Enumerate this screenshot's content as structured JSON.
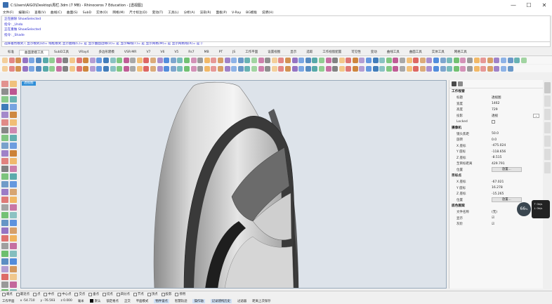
{
  "window": {
    "title": "C:\\Users\\AIGO\\Desktop\\周栏.3dm (7 MB) - Rhinoceros 7 Education - [透视图]",
    "buttons": [
      "minimize-icon",
      "maximize-icon",
      "close-icon"
    ],
    "btn_glyphs": [
      "—",
      "☐",
      "✕"
    ]
  },
  "menubar": [
    "文件(F)",
    "编辑(E)",
    "查看(V)",
    "曲线(C)",
    "曲面(S)",
    "SubD",
    "实体(O)",
    "网格(M)",
    "尺寸标注(D)",
    "变动(T)",
    "工具(L)",
    "分析(A)",
    "渲染(R)",
    "面板(P)",
    "V-Ray",
    "BG模板",
    "说明(H)"
  ],
  "command_history": [
    "正在删除 ShowSelected",
    "指令: _Undo",
    "正在重做 ShowSelected",
    "指令: _Shade"
  ],
  "command_prompt": "选择着色模式 ( 显示模式(D)= 线框模式 显示曲线(C)= 是 显示曲面边缘(U)= 是 显示细线(T)= 是 显示网格(M)= 是 显示网格线(X)= 是 ):",
  "tabs": [
    "标准",
    "曲面建模工具",
    "SubD工具",
    "VRay4",
    "多边形建模",
    "VSR-MR",
    "V7",
    "V6",
    "V5",
    "Rs7",
    "MB",
    "PT",
    "JS",
    "工作平面",
    "设置视图",
    "显示",
    "选取",
    "工作视窗配置",
    "可见性",
    "变动",
    "曲线工具",
    "曲面工具",
    "实体工具",
    "网格工具"
  ],
  "active_tab_index": 1,
  "viewport": {
    "label": "透视图"
  },
  "properties": {
    "section_viewport": "工作视窗",
    "rows_viewport": [
      {
        "k": "标题",
        "v": "透视图"
      },
      {
        "k": "宽度",
        "v": "1462"
      },
      {
        "k": "高度",
        "v": "729"
      },
      {
        "k": "投影",
        "v": "透视"
      },
      {
        "k": "Locked",
        "v": ""
      }
    ],
    "section_camera": "摄像机",
    "rows_camera": [
      {
        "k": "镜头焦距",
        "v": "50.0"
      },
      {
        "k": "旋转",
        "v": "0.0"
      },
      {
        "k": "X 座标",
        "v": "-475.024"
      },
      {
        "k": "Y 座标",
        "v": "-118.656"
      },
      {
        "k": "Z 座标",
        "v": "-8.515"
      },
      {
        "k": "至目标距离",
        "v": "429.791"
      },
      {
        "k": "位置",
        "v": "放置..."
      }
    ],
    "section_target": "目标点",
    "rows_target": [
      {
        "k": "X 座标",
        "v": "-67.021"
      },
      {
        "k": "Y 座标",
        "v": "16.278"
      },
      {
        "k": "Z 座标",
        "v": "-15.265"
      },
      {
        "k": "位置",
        "v": "放置..."
      }
    ],
    "section_wallpaper": "底色图案",
    "rows_wallpaper": [
      {
        "k": "文件名称",
        "v": "(无)"
      },
      {
        "k": "显示",
        "v": "☑"
      },
      {
        "k": "灰阶",
        "v": "☑"
      }
    ]
  },
  "zoom": {
    "value": "66",
    "unit": "%",
    "up": "↑ 0k/s",
    "down": "↓ 0k/s"
  },
  "osnap": [
    "端点",
    "最近点",
    "点",
    "中点",
    "中心点",
    "交点",
    "垂点",
    "切点",
    "四分点",
    "节点",
    "顶点",
    "投影",
    "停用"
  ],
  "statusbar": {
    "plane": "工作平面",
    "x": "x -54.710",
    "y": "y -76.593",
    "z": "z 0.000",
    "unit": "毫米",
    "layer": "默认",
    "items": [
      "锁定格点",
      "正交",
      "平面模式",
      "物件锁点",
      "智慧轨迹",
      "操作轴",
      "记录建构历史",
      "过滤器",
      "距离上次保存"
    ]
  },
  "colors": {
    "accent": "#2f8ed8",
    "viewport_bg": "#dde3ea",
    "command_text": "#2b2bcf"
  }
}
